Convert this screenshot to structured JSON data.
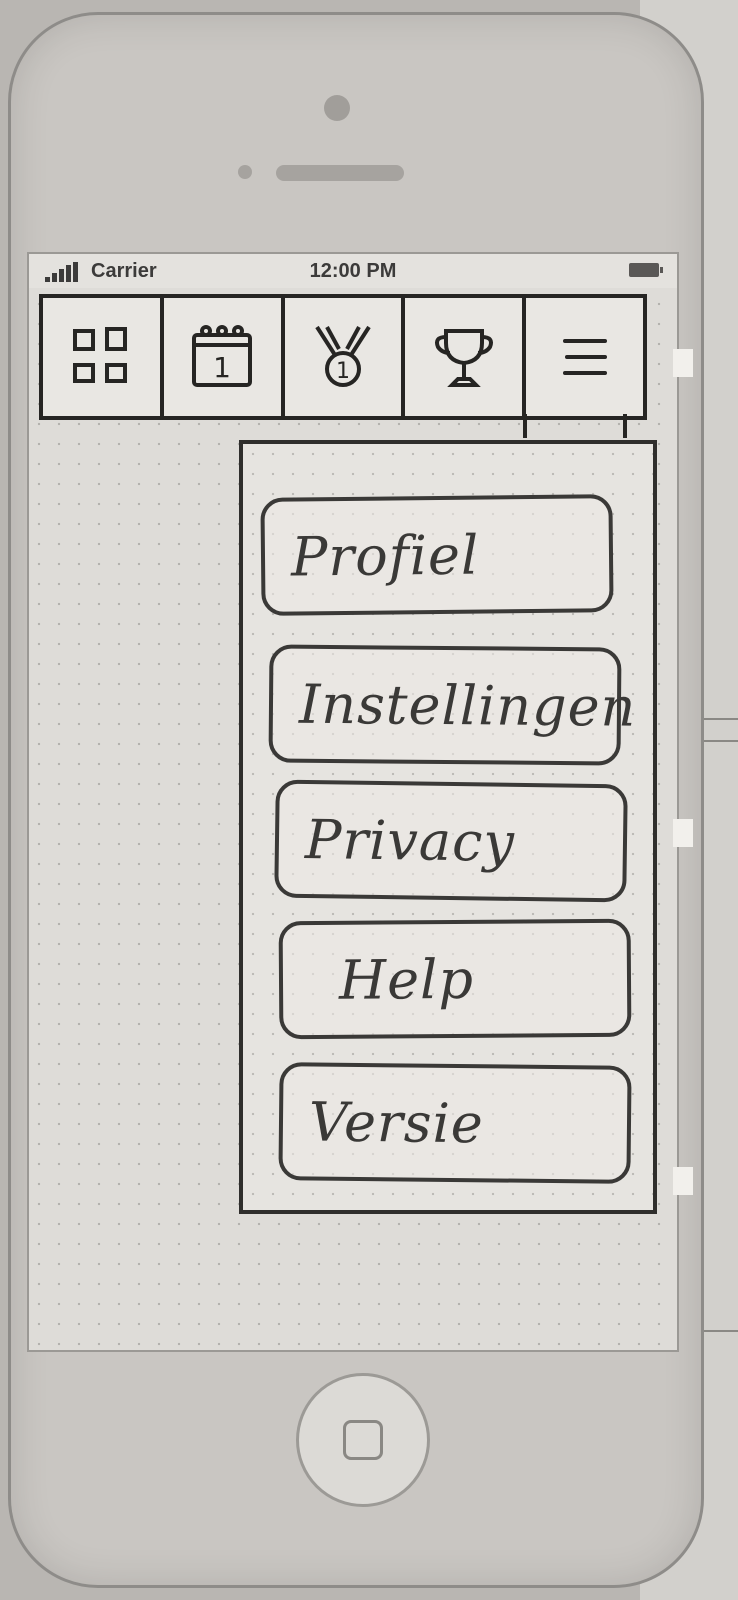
{
  "status_bar": {
    "carrier": "Carrier",
    "time": "12:00 PM"
  },
  "tabs": [
    {
      "id": "dashboard",
      "icon": "grid-icon"
    },
    {
      "id": "calendar",
      "icon": "calendar-icon",
      "badge": "1"
    },
    {
      "id": "medal",
      "icon": "medal-icon",
      "badge": "1"
    },
    {
      "id": "trophy",
      "icon": "trophy-icon"
    },
    {
      "id": "menu",
      "icon": "hamburger-menu-icon"
    }
  ],
  "menu": {
    "items": [
      {
        "label": "Profiel"
      },
      {
        "label": "Instellingen"
      },
      {
        "label": "Privacy"
      },
      {
        "label": "Help"
      },
      {
        "label": "Versie"
      }
    ]
  }
}
